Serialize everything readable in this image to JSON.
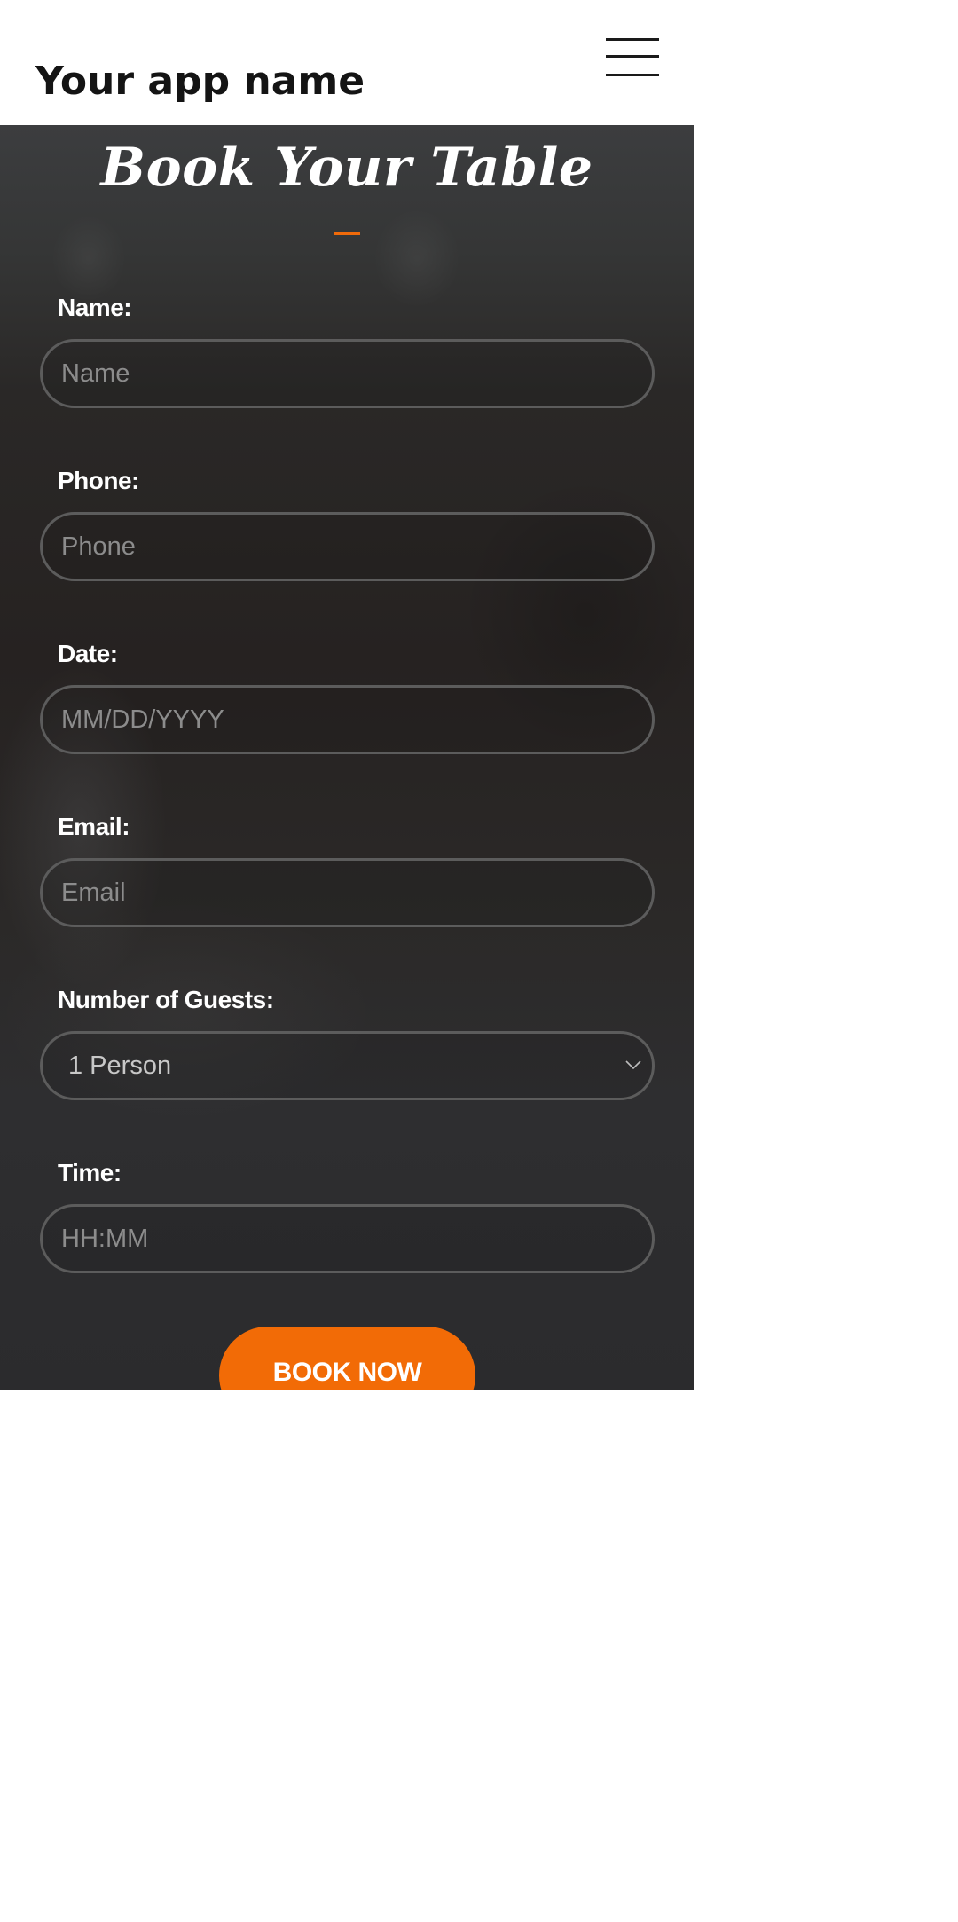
{
  "header": {
    "app_name": "Your app name",
    "menu_icon": "hamburger-menu-icon"
  },
  "hero": {
    "title": "Book Your Table",
    "accent_color": "#f06a0a"
  },
  "form": {
    "name": {
      "label": "Name:",
      "placeholder": "Name"
    },
    "phone": {
      "label": "Phone:",
      "placeholder": "Phone"
    },
    "date": {
      "label": "Date:",
      "placeholder": "MM/DD/YYYY"
    },
    "email": {
      "label": "Email:",
      "placeholder": "Email"
    },
    "guests": {
      "label": "Number of Guests:",
      "value": "1 Person",
      "icon": "chevron-down-icon"
    },
    "time": {
      "label": "Time:",
      "placeholder": "HH:MM"
    },
    "submit_label": "BOOK NOW",
    "submit_color": "#f26b06"
  }
}
